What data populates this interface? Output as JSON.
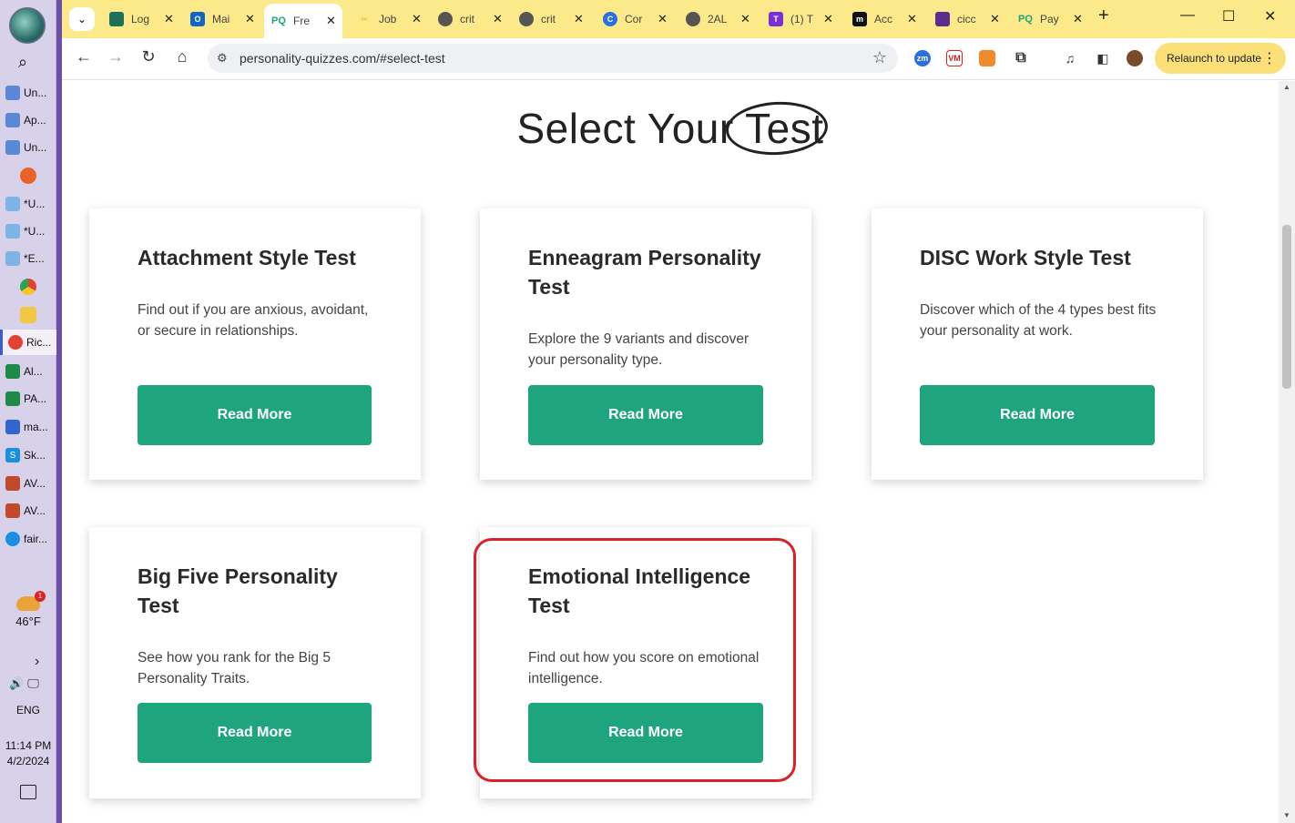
{
  "taskbar": {
    "items": [
      {
        "label": "Un...",
        "color": "#5b88d6"
      },
      {
        "label": "Ap...",
        "color": "#5b88d6"
      },
      {
        "label": "Un...",
        "color": "#5b88d6"
      },
      {
        "label": "*U...",
        "color": "#7fb3e6"
      },
      {
        "label": "*U...",
        "color": "#7fb3e6"
      },
      {
        "label": "*E...",
        "color": "#7fb3e6"
      },
      {
        "label": "Ric...",
        "color": "#e34133"
      },
      {
        "label": "Al...",
        "color": "#1d8a4a"
      },
      {
        "label": "PA...",
        "color": "#1d8a4a"
      },
      {
        "label": "ma...",
        "color": "#3366cc"
      },
      {
        "label": "Sk...",
        "color": "#1a8fe0"
      },
      {
        "label": "AV...",
        "color": "#c04a2a"
      },
      {
        "label": "AV...",
        "color": "#c04a2a"
      },
      {
        "label": "fair...",
        "color": "#1a8fe0"
      }
    ],
    "weather_temp": "46°F",
    "weather_badge": "1",
    "language": "ENG",
    "time": "11:14 PM",
    "date": "4/2/2024"
  },
  "browser": {
    "tabs": [
      {
        "label": "Log",
        "fav": "",
        "color": "#1f6f5a"
      },
      {
        "label": "Mai",
        "fav": "O",
        "color": "#1166c4"
      },
      {
        "label": "Fre",
        "fav": "PQ",
        "color": "#1ea57e",
        "active": true
      },
      {
        "label": "Job",
        "fav": "✂",
        "color": "#e6b400"
      },
      {
        "label": "crit",
        "fav": "",
        "color": "#444"
      },
      {
        "label": "crit",
        "fav": "",
        "color": "#444"
      },
      {
        "label": "Cor",
        "fav": "C",
        "color": "#2a6fe0"
      },
      {
        "label": "2AL",
        "fav": "",
        "color": "#444"
      },
      {
        "label": "(1) T",
        "fav": "T",
        "color": "#7b2fd6"
      },
      {
        "label": "Acc",
        "fav": "m",
        "color": "#111"
      },
      {
        "label": "cicc",
        "fav": "",
        "color": "#5b2d8f"
      },
      {
        "label": "Pay",
        "fav": "PQ",
        "color": "#1ea57e"
      }
    ],
    "url": "personality-quizzes.com/#select-test",
    "relaunch_label": "Relaunch to update"
  },
  "page": {
    "title_prefix": "Select Your",
    "title_highlight": "Test",
    "cards": [
      {
        "title": "Attachment Style Test",
        "description": "Find out if you are anxious, avoidant, or secure in relationships.",
        "button": "Read More"
      },
      {
        "title": "Enneagram Personality Test",
        "description": "Explore the 9 variants and discover your personality type.",
        "button": "Read More"
      },
      {
        "title": "DISC Work Style Test",
        "description": "Discover which of the 4 types best fits your personality at work.",
        "button": "Read More"
      },
      {
        "title": "Big Five Personality Test",
        "description": "See how you rank for the Big 5 Personality Traits.",
        "button": "Read More"
      },
      {
        "title": "Emotional Intelligence Test",
        "description": "Find out how you score on emotional intelligence.",
        "button": "Read More"
      }
    ],
    "accent_color": "#1ea57e",
    "highlight_color": "#d8232a"
  }
}
